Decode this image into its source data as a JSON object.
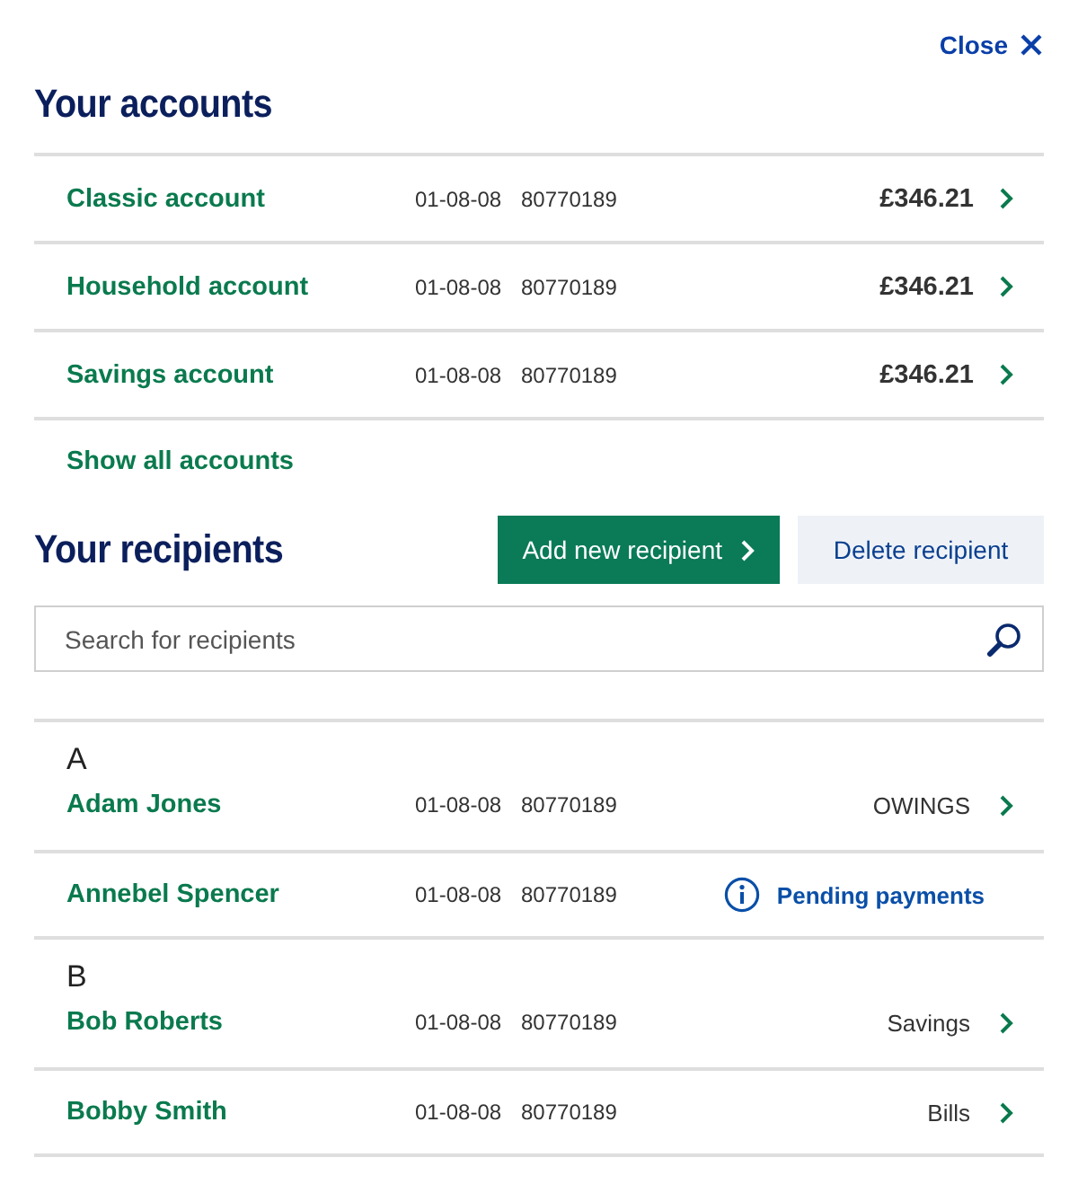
{
  "close": {
    "label": "Close"
  },
  "accounts": {
    "title": "Your accounts",
    "items": [
      {
        "name": "Classic account",
        "sort_code": "01-08-08",
        "number": "80770189",
        "balance": "£346.21"
      },
      {
        "name": "Household account",
        "sort_code": "01-08-08",
        "number": "80770189",
        "balance": "£346.21"
      },
      {
        "name": "Savings account",
        "sort_code": "01-08-08",
        "number": "80770189",
        "balance": "£346.21"
      }
    ],
    "show_all": "Show all accounts"
  },
  "recipients": {
    "title": "Your recipients",
    "add_button": "Add new recipient",
    "delete_button": "Delete recipient",
    "search": {
      "placeholder": "Search for recipients"
    },
    "groups": [
      {
        "letter": "A",
        "items": [
          {
            "name": "Adam Jones",
            "sort_code": "01-08-08",
            "number": "80770189",
            "kind": "reference",
            "note": "OWINGS"
          },
          {
            "name": "Annebel Spencer",
            "sort_code": "01-08-08",
            "number": "80770189",
            "kind": "pending",
            "note": "Pending payments"
          }
        ]
      },
      {
        "letter": "B",
        "items": [
          {
            "name": "Bob Roberts",
            "sort_code": "01-08-08",
            "number": "80770189",
            "kind": "reference",
            "note": "Savings"
          },
          {
            "name": "Bobby Smith",
            "sort_code": "01-08-08",
            "number": "80770189",
            "kind": "reference",
            "note": "Bills"
          }
        ]
      }
    ]
  }
}
